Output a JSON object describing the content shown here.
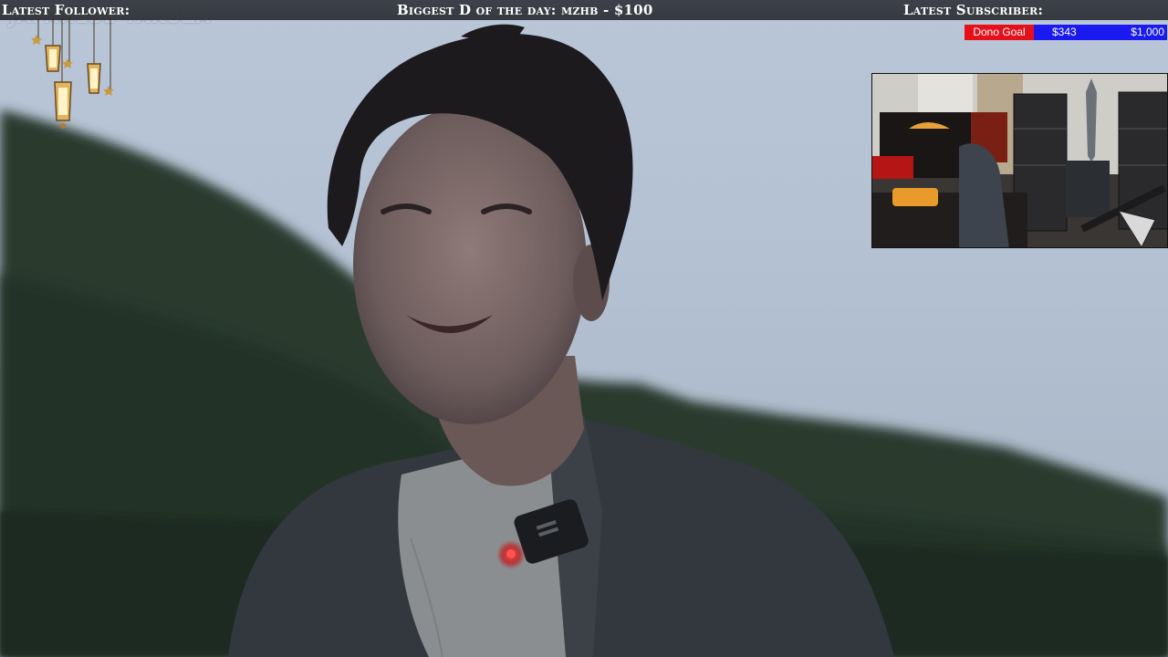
{
  "overlay": {
    "latest_follower_label": "Latest Follower:",
    "latest_follower_name": "JAPANESE YAKUZA",
    "biggest_donation_label": "Biggest D of the day:",
    "biggest_donation_value": "mzhb - $100",
    "latest_subscriber_label": "Latest Subscriber:"
  },
  "donation_goal": {
    "label": "Dono Goal",
    "current": "$343",
    "target": "$1,000",
    "progress": 0.343,
    "colors": {
      "label_bg": "#e5101a",
      "bar_bg": "#1a1af0"
    }
  },
  "icons": [
    "lantern-icon",
    "star-icon"
  ]
}
